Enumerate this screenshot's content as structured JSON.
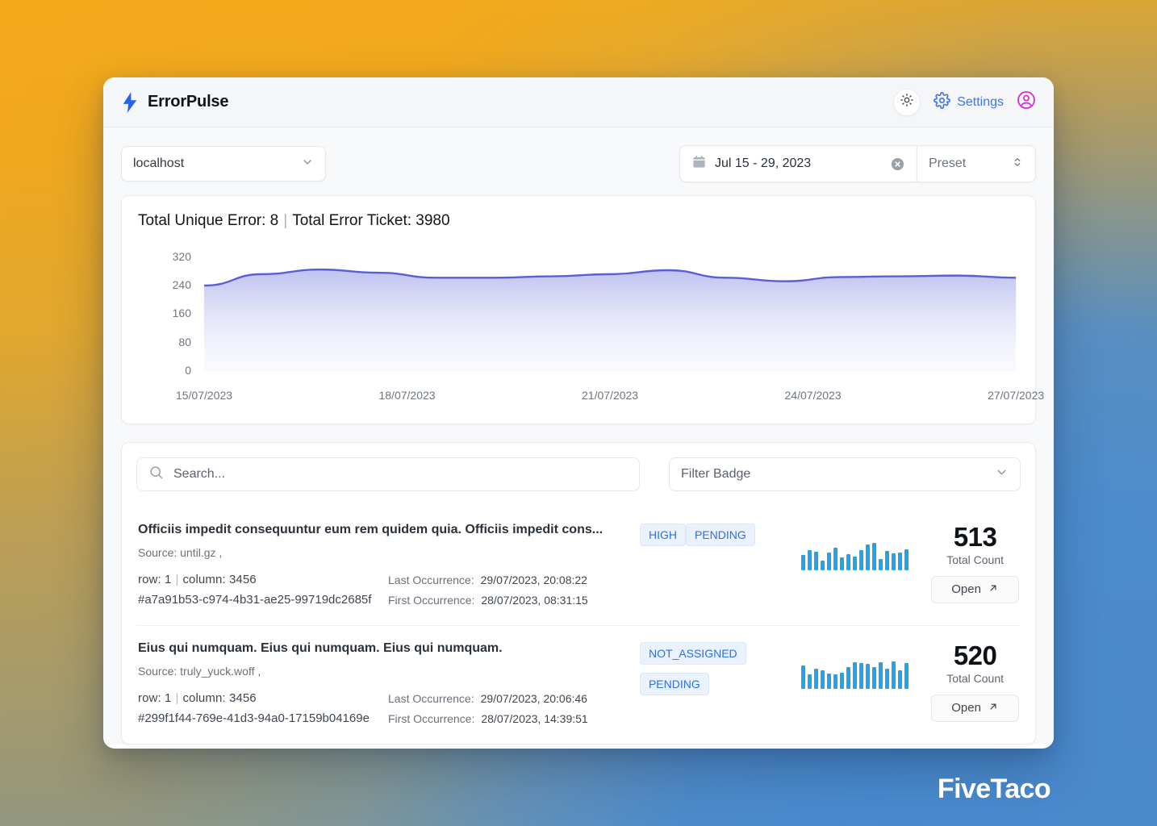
{
  "brand": {
    "name": "ErrorPulse",
    "icon": "bolt-icon",
    "color": "#2563eb"
  },
  "topbar": {
    "theme_toggle_icon": "sun-icon",
    "settings_label": "Settings",
    "settings_icon": "gear-icon",
    "avatar_icon": "user-circle-icon",
    "settings_color": "#4274e8",
    "avatar_color": "#d82fd0"
  },
  "filters": {
    "host_value": "localhost",
    "host_chevron_icon": "chevron-down-icon",
    "date_icon": "calendar-icon",
    "date_value": "Jul 15 - 29, 2023",
    "date_clear_icon": "clear-circle-icon",
    "preset_value": "Preset",
    "preset_icon": "chevron-updown-icon"
  },
  "summary": {
    "unique_label": "Total Unique Error: 8",
    "separator": "|",
    "ticket_label": "Total Error Ticket: 3980"
  },
  "chart_data": {
    "type": "area",
    "title": "Total Unique Error: 8 | Total Error Ticket: 3980",
    "xlabel": "",
    "ylabel": "",
    "ylim": [
      0,
      360
    ],
    "yticks": [
      0,
      80,
      160,
      240,
      320
    ],
    "xticks": [
      "15/07/2023",
      "18/07/2023",
      "21/07/2023",
      "24/07/2023",
      "27/07/2023"
    ],
    "grid": false,
    "legend": "none",
    "line_color": "#5b5fd6",
    "fill_color": "#c9cbf3",
    "x": [
      "15/07/2023",
      "16/07/2023",
      "17/07/2023",
      "18/07/2023",
      "19/07/2023",
      "20/07/2023",
      "21/07/2023",
      "22/07/2023",
      "23/07/2023",
      "24/07/2023",
      "25/07/2023",
      "26/07/2023",
      "27/07/2023",
      "28/07/2023",
      "29/07/2023"
    ],
    "values": [
      240,
      272,
      285,
      276,
      262,
      262,
      266,
      272,
      283,
      262,
      252,
      264,
      266,
      268,
      262
    ]
  },
  "list": {
    "search_placeholder": "Search...",
    "search_value": "",
    "search_icon": "search-icon",
    "badge_filter_label": "Filter Badge",
    "badge_filter_icon": "chevron-down-icon",
    "count_label": "Total Count",
    "open_label": "Open",
    "open_icon": "arrow-up-right-icon",
    "row_label": "row:",
    "column_label": "column:",
    "source_label": "Source:",
    "last_occurrence_label": "Last Occurrence:",
    "first_occurrence_label": "First Occurrence:",
    "rows": [
      {
        "title": "Officiis impedit consequuntur eum rem quidem quia. Officiis impedit cons...",
        "source": "Source: until.gz ,",
        "row": "1",
        "column": "3456",
        "hash": "#a7a91b53-c974-4b31-ae25-99719dc2685f",
        "last_occurrence": "29/07/2023, 20:08:22",
        "first_occurrence": "28/07/2023, 08:31:15",
        "badges": [
          "HIGH",
          "PENDING"
        ],
        "sparkline": [
          20,
          26,
          24,
          12,
          23,
          29,
          17,
          21,
          18,
          26,
          33,
          35,
          14,
          25,
          22,
          23,
          27
        ],
        "count": "513"
      },
      {
        "title": "Eius qui numquam. Eius qui numquam. Eius qui numquam.",
        "source": "Source: truly_yuck.woff ,",
        "row": "1",
        "column": "3456",
        "hash": "#299f1f44-769e-41d3-94a0-17159b04169e",
        "last_occurrence": "29/07/2023, 20:06:46",
        "first_occurrence": "28/07/2023, 14:39:51",
        "badges": [
          "NOT_ASSIGNED",
          "PENDING"
        ],
        "sparkline": [
          27,
          17,
          24,
          22,
          18,
          17,
          19,
          26,
          31,
          30,
          29,
          26,
          31,
          24,
          32,
          22,
          30
        ],
        "count": "520"
      }
    ]
  },
  "watermark": {
    "text": "FiveTaco"
  }
}
